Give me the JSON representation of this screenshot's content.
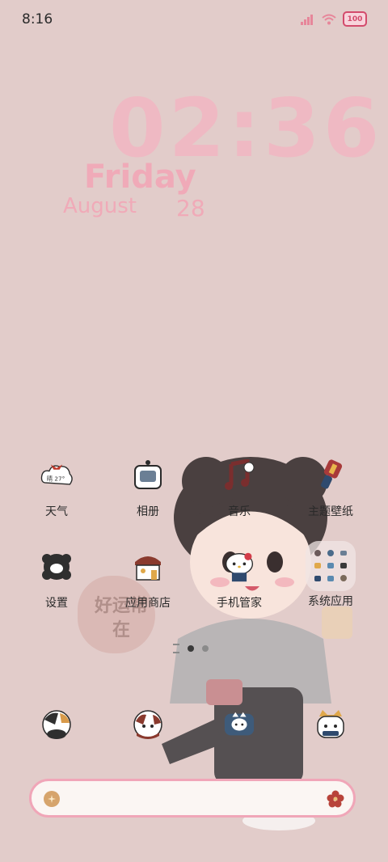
{
  "status_bar": {
    "time": "8:16",
    "battery": "100"
  },
  "clock": {
    "time": "02:36",
    "day": "Friday",
    "month": "August",
    "date": "28"
  },
  "stamp_text": "好运常在",
  "apps_row1": [
    {
      "label": "天气",
      "icon": "weather-icon",
      "badge": "晴 27°"
    },
    {
      "label": "相册",
      "icon": "gallery-icon"
    },
    {
      "label": "音乐",
      "icon": "music-icon"
    },
    {
      "label": "主题壁纸",
      "icon": "theme-wallpaper-icon"
    }
  ],
  "apps_row2": [
    {
      "label": "设置",
      "icon": "settings-icon"
    },
    {
      "label": "应用商店",
      "icon": "app-store-icon"
    },
    {
      "label": "手机管家",
      "icon": "phone-manager-icon"
    },
    {
      "label": "系统应用",
      "icon": "system-apps-folder-icon"
    }
  ],
  "dock": [
    {
      "icon": "phone-cat-icon"
    },
    {
      "icon": "messages-cat-icon"
    },
    {
      "icon": "chat-cat-icon"
    },
    {
      "icon": "camera-cat-icon"
    }
  ],
  "page_indicator": {
    "pages": 2,
    "current": 1
  },
  "colors": {
    "background": "#e2ccca",
    "accent": "#f0a6b8",
    "clock": "#f2b6c2"
  }
}
